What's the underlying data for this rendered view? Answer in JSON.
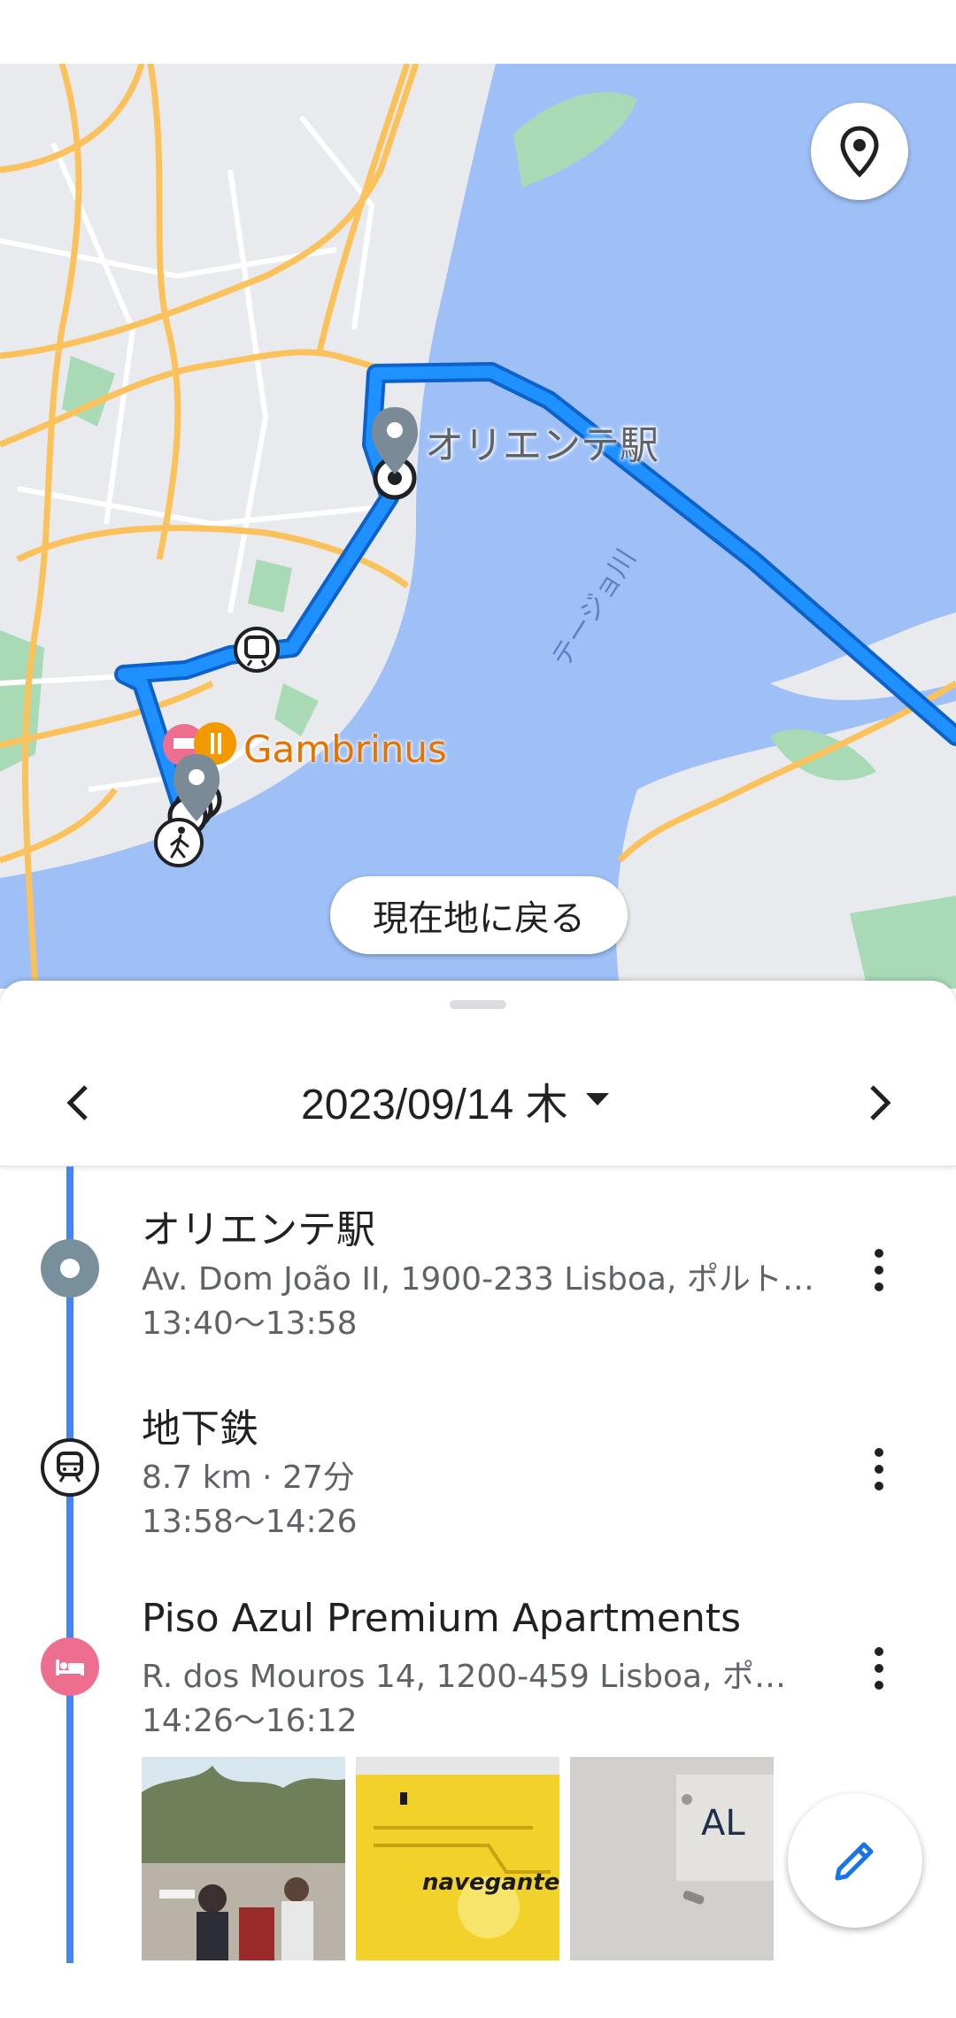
{
  "map": {
    "station_label": "オリエンテ駅",
    "river_label": "テージョ川",
    "poi_label": "Gambrinus",
    "recenter_label": "現在地に戻る",
    "colors": {
      "water": "#9ec0f7",
      "land": "#e8eaed",
      "route": "#1a8cff",
      "road": "#fbc15a",
      "park": "#a8dab5"
    }
  },
  "sheet": {
    "date_label": "2023/09/14 木",
    "entries": [
      {
        "title": "オリエンテ駅",
        "address": "Av. Dom João II, 1900-233 Lisboa, ポルト…",
        "time": "13:40〜13:58",
        "icon": "place-dot-icon"
      },
      {
        "title": "地下鉄",
        "detail": "8.7 km · 27分",
        "time": "13:58〜14:26",
        "icon": "subway-icon"
      },
      {
        "title": "Piso Azul Premium Apartments",
        "address": "R. dos Mouros 14, 1200-459 Lisboa, ポル…",
        "time": "14:26〜16:12",
        "icon": "hotel-icon"
      }
    ],
    "photos": [
      {
        "name": "cafe-terrace-photo"
      },
      {
        "name": "navegante-card-photo",
        "text": "navegante"
      },
      {
        "name": "al-sign-photo",
        "text": "AL"
      }
    ]
  }
}
